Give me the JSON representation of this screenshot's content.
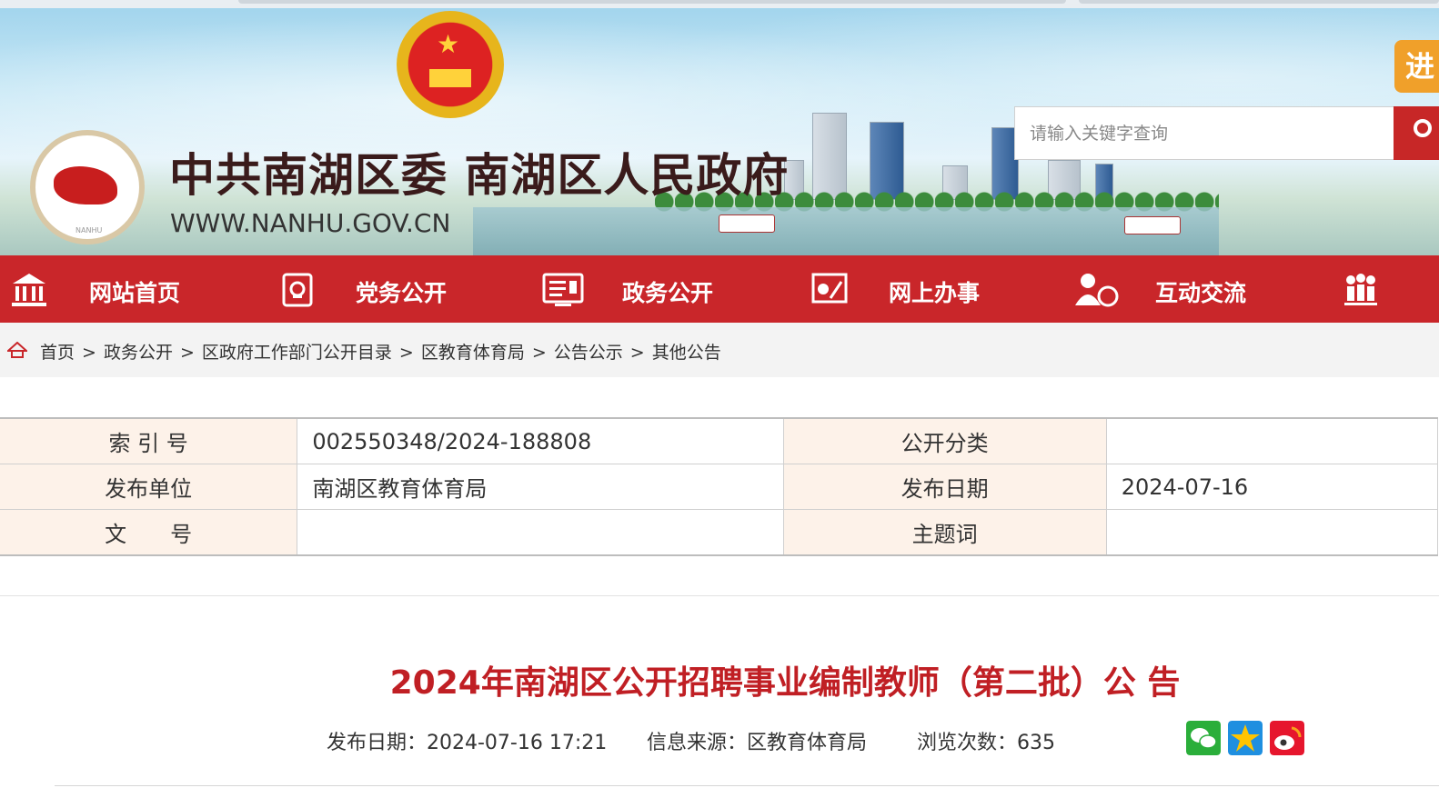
{
  "header": {
    "site_title": "中共南湖区委 南湖区人民政府",
    "site_url": "WWW.NANHU.GOV.CN",
    "logo_text": "NANHU",
    "search_placeholder": "请输入关键字查询",
    "enter_label": "进"
  },
  "nav": {
    "items": [
      {
        "label": "网站首页",
        "icon": "building-icon"
      },
      {
        "label": "党务公开",
        "icon": "party-flag-icon"
      },
      {
        "label": "政务公开",
        "icon": "document-icon"
      },
      {
        "label": "网上办事",
        "icon": "service-icon"
      },
      {
        "label": "互动交流",
        "icon": "people-chat-icon"
      },
      {
        "label": "",
        "icon": "group-icon"
      }
    ]
  },
  "breadcrumb": {
    "items": [
      "首页",
      "政务公开",
      "区政府工作部门公开目录",
      "区教育体育局",
      "公告公示",
      "其他公告"
    ],
    "separator": ">"
  },
  "info_table": {
    "rows": [
      {
        "k1": "索 引 号",
        "v1": "002550348/2024-188808",
        "k2": "公开分类",
        "v2": ""
      },
      {
        "k1": "发布单位",
        "v1": "南湖区教育体育局",
        "k2": "发布日期",
        "v2": "2024-07-16"
      },
      {
        "k1": "文　　号",
        "v1": "",
        "k2": "主题词",
        "v2": ""
      }
    ]
  },
  "article": {
    "title": "2024年南湖区公开招聘事业编制教师（第二批）公 告",
    "publish_date": "发布日期：2024-07-16 17:21",
    "source": "信息来源：区教育体育局",
    "views": "浏览次数：635"
  },
  "share": [
    "wechat-icon",
    "qzone-icon",
    "weibo-icon"
  ],
  "colors": {
    "brand_red": "#c9262a",
    "title_red": "#c01f24",
    "key_bg": "#fdf2e9",
    "enter_orange": "#f0a02a"
  }
}
